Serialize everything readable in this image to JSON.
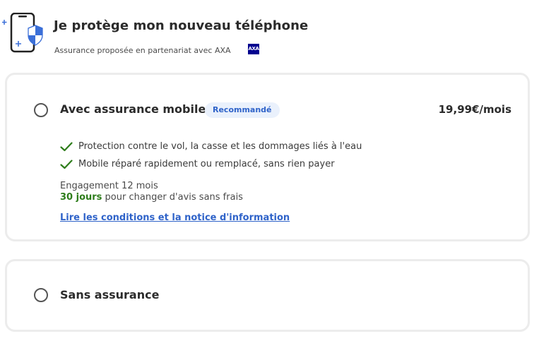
{
  "header": {
    "title": "Je protège mon nouveau téléphone",
    "subtitle": "Assurance proposée en partenariat avec AXA",
    "partner_logo_text": "AXA",
    "icon": "phone-shield-icon"
  },
  "options": [
    {
      "title": "Avec assurance mobile",
      "badge": "Recommandé",
      "price": "19,99€/mois",
      "selected": false,
      "benefits": [
        "Protection contre le vol, la casse et les dommages liés à l'eau",
        "Mobile réparé rapidement ou remplacé, sans rien payer"
      ],
      "engagement": "Engagement 12 mois",
      "delay_strong": "30 jours",
      "delay_rest": " pour changer d'avis sans frais",
      "link": "Lire les conditions et la notice d'information"
    },
    {
      "title": "Sans assurance",
      "selected": false
    }
  ],
  "colors": {
    "accent_blue": "#2f63c9",
    "success_green": "#2e7d1b",
    "badge_bg": "#eaf1fc",
    "card_border": "#ececec",
    "axa_blue": "#00008f"
  }
}
